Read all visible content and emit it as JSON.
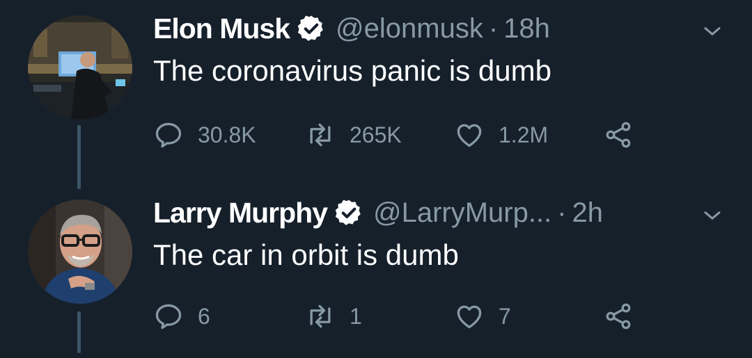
{
  "colors": {
    "background": "#15202b",
    "secondary_text": "#8899a6",
    "verified_badge": "#ffffff",
    "thread_line": "#3d5466"
  },
  "tweets": [
    {
      "display_name": "Elon Musk",
      "handle": "@elonmusk",
      "separator": "·",
      "time": "18h",
      "text": "The coronavirus panic is dumb",
      "verified": true,
      "replies": "30.8K",
      "retweets": "265K",
      "likes": "1.2M",
      "avatar_icon": "avatar-photo-studio"
    },
    {
      "display_name": "Larry Murphy",
      "handle": "@LarryMurp...",
      "separator": "·",
      "time": "2h",
      "text": "The car in orbit is dumb",
      "verified": true,
      "replies": "6",
      "retweets": "1",
      "likes": "7",
      "avatar_icon": "avatar-photo-man-glasses"
    }
  ],
  "icons": [
    "verified-badge-icon",
    "chevron-down-icon",
    "reply-icon",
    "retweet-icon",
    "like-icon",
    "share-icon"
  ]
}
